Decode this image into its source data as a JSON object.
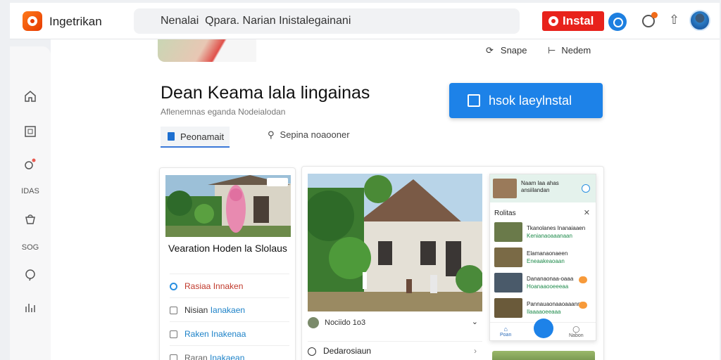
{
  "header": {
    "app_name": "Ingetrikan",
    "search_value": "Nenalai  Qpara. Narian Inistalegainani",
    "install_label": "Instal"
  },
  "sidebar": {
    "items": [
      {
        "icon": "home-icon",
        "label": ""
      },
      {
        "icon": "square-icon",
        "label": ""
      },
      {
        "icon": "pin-icon",
        "label": ""
      },
      {
        "icon": "",
        "label": "IDAS"
      },
      {
        "icon": "bag-icon",
        "label": ""
      },
      {
        "icon": "",
        "label": "SOG"
      },
      {
        "icon": "help-icon",
        "label": ""
      },
      {
        "icon": "chart-icon",
        "label": ""
      }
    ]
  },
  "main": {
    "share_label": "Snape",
    "new_label": "Nedem",
    "title": "Dean Keama lala lingainas",
    "subtitle": "Aflenemnas eganda Nodeialodan",
    "cta_label": "hsok laeylnstal",
    "tabs": [
      {
        "label": "Peonamait"
      },
      {
        "label": "Sepina noaooner"
      }
    ]
  },
  "card1": {
    "title": "Vearation Hoden la Slolaus",
    "rows": [
      {
        "label": "Rasiaa",
        "link": "Innaken",
        "color": "#c0392b"
      },
      {
        "label": "Nisian",
        "link": "Ianakaen",
        "color": "#1d82c8"
      },
      {
        "label": "Raken",
        "link": "Inakenaa",
        "color": "#1d82c8"
      },
      {
        "label": "Raran",
        "link": "Inakaean",
        "color": "#1d82c8"
      }
    ]
  },
  "card2": {
    "row1": "Nociido 1o3",
    "row2": "Dedarosiaun"
  },
  "panel": {
    "header_text": "Naam laa ahas ansiilandan",
    "section_title": "Rolitas",
    "items": [
      {
        "line1": "Tkanolanes Inanaiaaen",
        "line2": "Kenianaoaaanaan"
      },
      {
        "line1": "Elamanaonaeen",
        "line2": "Eneaakeaoaan"
      },
      {
        "line1": "Dananaonaa-oaaa",
        "line2": "Hoanaaooeeeaa"
      },
      {
        "line1": "Pannauaonaaoaaannn",
        "line2": "Ilaaaaoeeaaa"
      }
    ],
    "bottom": [
      "Poan",
      "Nabon"
    ]
  },
  "colors": {
    "install_red": "#e8221b",
    "primary_blue": "#1d82e8"
  }
}
